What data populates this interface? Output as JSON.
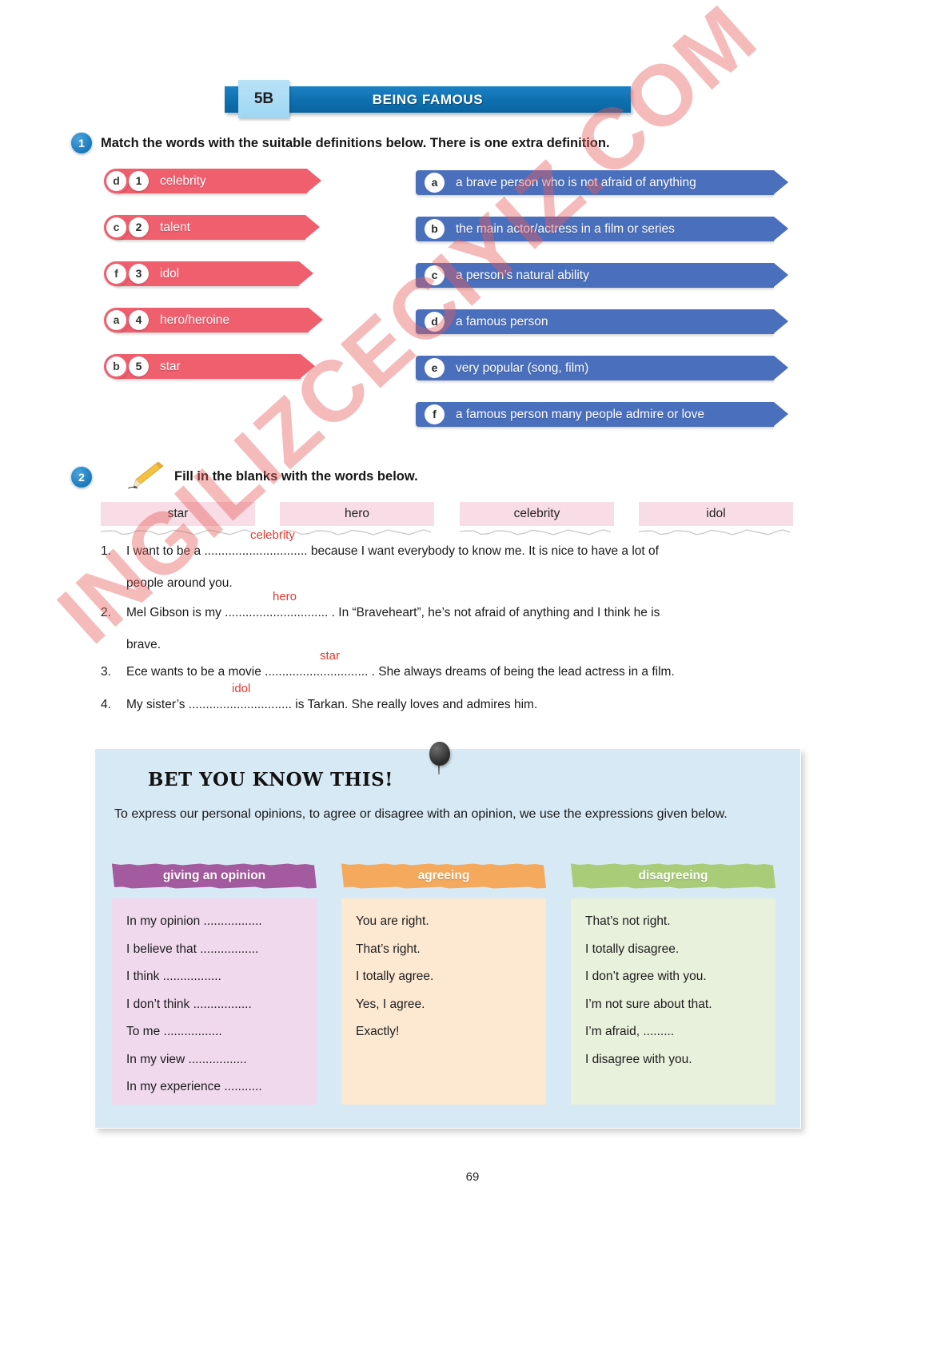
{
  "unit": {
    "code": "5B",
    "title": "BEING FAMOUS"
  },
  "exercise1": {
    "number": "1",
    "instruction": "Match the words with the suitable definitions below. There is one extra definition.",
    "words": [
      {
        "num": "1",
        "answer": "d",
        "text": "celebrity"
      },
      {
        "num": "2",
        "answer": "c",
        "text": "talent"
      },
      {
        "num": "3",
        "answer": "f",
        "text": "idol"
      },
      {
        "num": "4",
        "answer": "a",
        "text": "hero/heroine"
      },
      {
        "num": "5",
        "answer": "b",
        "text": "star"
      }
    ],
    "definitions": [
      {
        "letter": "a",
        "text": "a brave person who is not afraid of anything"
      },
      {
        "letter": "b",
        "text": "the main actor/actress in a film or series"
      },
      {
        "letter": "c",
        "text": "a person’s natural ability"
      },
      {
        "letter": "d",
        "text": "a famous person"
      },
      {
        "letter": "e",
        "text": "very popular (song, film)"
      },
      {
        "letter": "f",
        "text": "a famous person many people admire or love"
      }
    ]
  },
  "exercise2": {
    "number": "2",
    "instruction": "Fill in the blanks with the words below.",
    "wordbank": [
      "star",
      "hero",
      "celebrity",
      "idol"
    ],
    "items": [
      {
        "num": "1.",
        "before": "I want to be a ",
        "dots": "..............................",
        "answer": "celebrity",
        "after": " because I want everybody to know me. It is nice to have a lot of",
        "line2": "people around you."
      },
      {
        "num": "2.",
        "before": "Mel Gibson is my ",
        "dots": "..............................",
        "answer": "hero",
        "after": " . In “Braveheart”, he’s not afraid of anything and I think he is",
        "line2": "brave."
      },
      {
        "num": "3.",
        "before": "Ece wants to be a movie ",
        "dots": "..............................",
        "answer": "star",
        "after": " . She always dreams of being the lead actress in a film.",
        "line2": ""
      },
      {
        "num": "4.",
        "before": "My sister’s ",
        "dots": "..............................",
        "answer": "idol",
        "after": " is Tarkan. She really loves and admires him.",
        "line2": ""
      }
    ]
  },
  "infobox": {
    "title": "BET YOU KNOW THIS!",
    "intro": "To express our personal opinions, to agree or disagree with an opinion, we use the expressions given below.",
    "columns": [
      {
        "heading": "giving an opinion",
        "header_color": "#a45a9e",
        "body_color": "#f0d8ed",
        "items": [
          "In my opinion .................",
          "I believe that .................",
          "I think .................",
          "I don’t think .................",
          "To me .................",
          "In my view .................",
          "In my experience ..........."
        ]
      },
      {
        "heading": "agreeing",
        "header_color": "#f4a95c",
        "body_color": "#fde8d2",
        "items": [
          "You are right.",
          "That’s right.",
          "I totally agree.",
          "Yes, I agree.",
          "Exactly!"
        ]
      },
      {
        "heading": "disagreeing",
        "header_color": "#a8cc77",
        "body_color": "#e8f1dc",
        "items": [
          "That’s not right.",
          "I totally disagree.",
          "I don’t agree with you.",
          "I’m not sure about that.",
          "I’m afraid, .........",
          "I disagree with you."
        ]
      }
    ]
  },
  "watermark": {
    "text": "INGILIZCECIYIZ.COM"
  },
  "page_number": "69",
  "colors": {
    "pink_pill": "#ef5f6e",
    "blue_pill": "#4a6fbd",
    "banner_blue": "#0f6fae",
    "answer_red": "#e03a32"
  }
}
